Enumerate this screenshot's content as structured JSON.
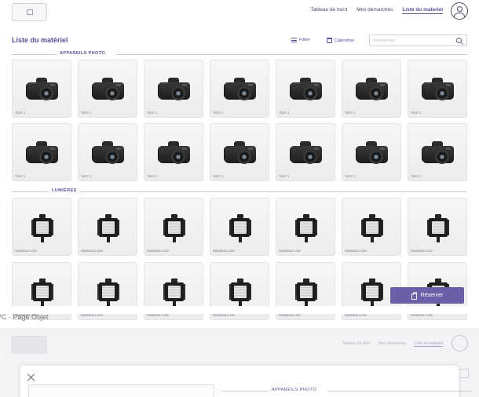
{
  "header": {
    "nav": [
      {
        "label": "Tableau de bord",
        "active": false
      },
      {
        "label": "Mes démarches",
        "active": false
      },
      {
        "label": "Liste du materiel",
        "active": true
      }
    ]
  },
  "page": {
    "title": "Liste du matériel",
    "filter_label": "Filtrer",
    "calendar_label": "Calendrier",
    "search_placeholder": "Rechercher"
  },
  "sections": [
    {
      "label": "APPAREILS PHOTO",
      "item_caption": "TEST 1",
      "item_icon": "camera-icon"
    },
    {
      "label": "LUMIÈRES",
      "item_caption": "PANNEAU LED",
      "item_icon": "led-panel-icon"
    }
  ],
  "reserve_button": {
    "label": "Réserver",
    "icon": "bag-icon",
    "color": "#6c5fa8"
  },
  "next_frame": {
    "label": "PC - Page Objet",
    "nav": [
      {
        "label": "Tableau de bord"
      },
      {
        "label": "Mes démarches"
      },
      {
        "label": "Liste du materiel"
      }
    ],
    "modal_section_label": "APPAREILS PHOTO"
  },
  "colors": {
    "accent": "#5a4f9a",
    "button": "#6c5fa8",
    "text": "#4a4a6a"
  }
}
